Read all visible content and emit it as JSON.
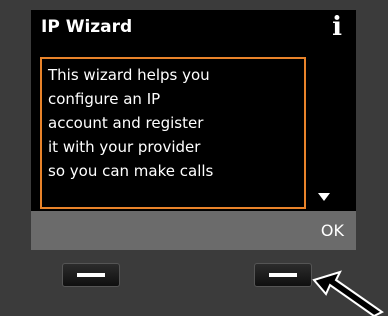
{
  "header": {
    "title": "IP Wizard",
    "info_icon": "i"
  },
  "message": {
    "lines": [
      "This wizard helps you",
      "configure an IP",
      "account and register",
      "it with your provider",
      "so you can make calls"
    ]
  },
  "softkeys": {
    "right_label": "OK"
  },
  "colors": {
    "highlight_border": "#e8832a",
    "softkey_bar": "#6b6b6b",
    "device_body": "#3b3b3b"
  }
}
